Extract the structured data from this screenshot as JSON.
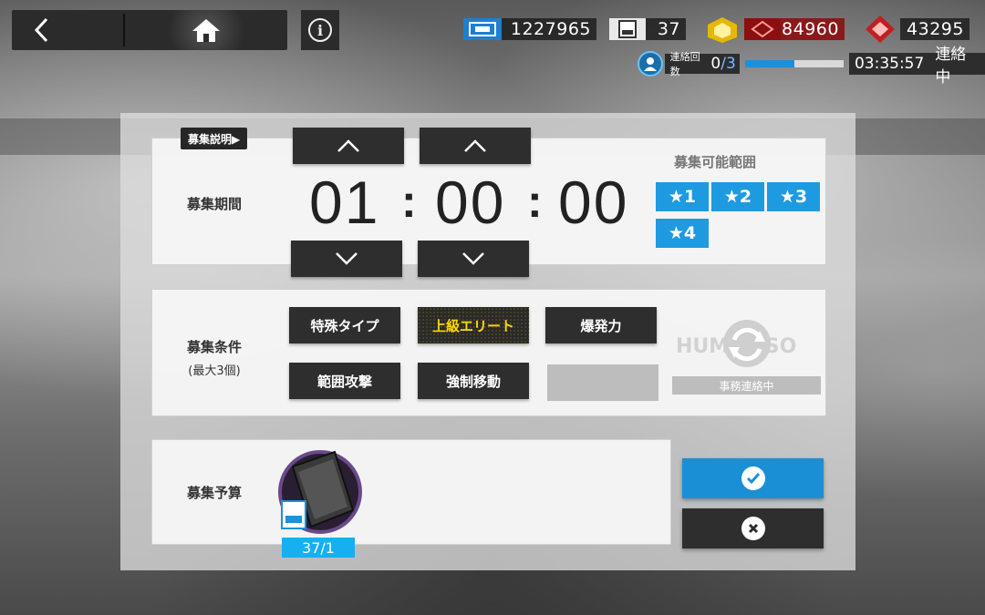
{
  "topbar": {
    "back_icon": "chevron-left-icon",
    "home_icon": "home-icon",
    "info_label": "i"
  },
  "resources": {
    "sanity": "1227965",
    "recruit_permits": "37",
    "originium_prime": "84960",
    "orundum": "43295"
  },
  "contact": {
    "label": "連絡回数",
    "current": "0",
    "total": "/3",
    "progress": 0.5,
    "time": "03:35:57",
    "status": "連絡中"
  },
  "recruit": {
    "explain_tag": "募集説明▶",
    "period_label": "募集期間",
    "hours": "01",
    "minutes": "00",
    "seconds": "00",
    "colon": ":",
    "range_title": "募集可能範囲",
    "stars": [
      "★1",
      "★2",
      "★3",
      "★4"
    ],
    "conditions_label": "募集条件",
    "conditions_sub": "(最大3個)",
    "tags": [
      {
        "label": "特殊タイプ",
        "selected": false
      },
      {
        "label": "上級エリート",
        "selected": true
      },
      {
        "label": "爆発力",
        "selected": false
      },
      {
        "label": "範囲攻撃",
        "selected": false
      },
      {
        "label": "強制移動",
        "selected": false
      }
    ],
    "hr_status": "事務連絡中",
    "budget_label": "募集予算",
    "permit_count": "37/1"
  },
  "colors": {
    "accent_blue": "#1b8fd6",
    "star_blue": "#1e9ae0",
    "selected_yellow": "#ffd800",
    "dark_button": "#2e2e2e"
  }
}
